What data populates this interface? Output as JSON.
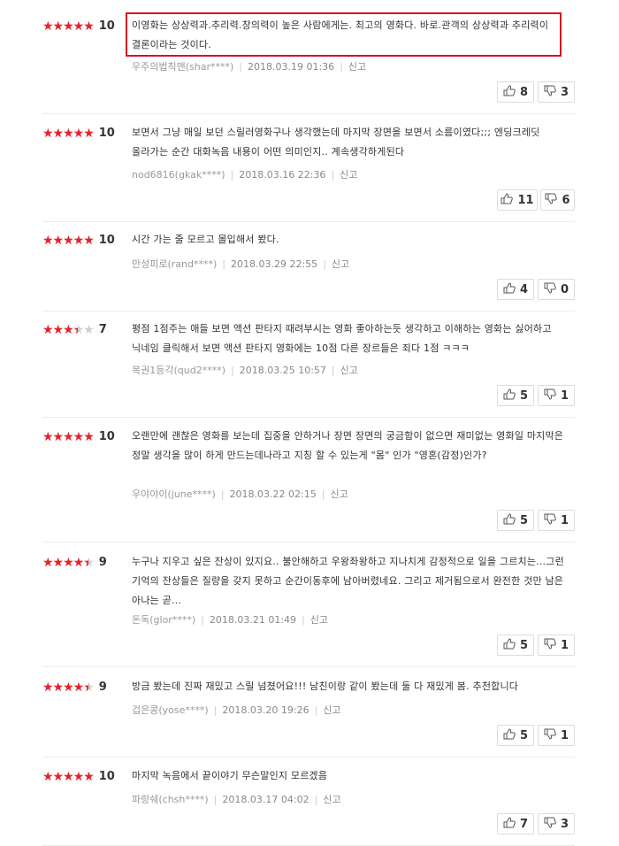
{
  "reviews": [
    {
      "rating": 10,
      "stars_fill": 1.0,
      "text": "이영화는 상상력과.추리력.창의력이 높은 사람에게는. 최고의 영화다. 바로.관객의 상상력과 추리력이 결론이라는 것이다.",
      "author": "우주의법칙맨(shar****)",
      "date": "2018.03.19 01:36",
      "report": "신고",
      "likes": "8",
      "dislikes": "3"
    },
    {
      "rating": 10,
      "stars_fill": 1.0,
      "text": "보면서 그냥 매일 보던 스릴러영화구나 생각했는데 마지막 장면을 보면서 소름이였다;;; 엔딩크레딧 올라가는 순간 대화녹음 내용이 어떤 의미인지.. 계속생각하게된다",
      "author": "nod6816(gkak****)",
      "date": "2018.03.16 22:36",
      "report": "신고",
      "likes": "11",
      "dislikes": "6"
    },
    {
      "rating": 10,
      "stars_fill": 1.0,
      "text": "시간 가는 줄 모르고 몰입해서 봤다.",
      "author": "만성피로(rand****)",
      "date": "2018.03.29 22:55",
      "report": "신고",
      "likes": "4",
      "dislikes": "0"
    },
    {
      "rating": 7,
      "stars_fill": 0.7,
      "text": "평점 1점주는 애들 보면 액션 판타지 때려부시는 영화 좋아하는듯 생각하고 이해하는 영화는 싫어하고 닉네임 클릭해서 보면 액션 판타지 영화에는 10점 다른 장르들은 죄다 1점 ㅋㅋㅋ",
      "author": "복권1등각(qud2****)",
      "date": "2018.03.25 10:57",
      "report": "신고",
      "likes": "5",
      "dislikes": "1"
    },
    {
      "rating": 10,
      "stars_fill": 1.0,
      "text": "오랜만에 괜찮은 영화를 보는데 집중을 안하거나 장면 장면의 궁금함이 없으면 재미없는 영화일 마지막은 정말 생각을 많이 하게 만드는데나라고 지칭 할 수 있는게 \"몸\" 인가 \"영혼(감정)인가?",
      "author": "우야야이(june****)",
      "date": "2018.03.22 02:15",
      "report": "신고",
      "likes": "5",
      "dislikes": "1"
    },
    {
      "rating": 9,
      "stars_fill": 0.9,
      "text": "누구나 지우고 싶은 잔상이 있지요.. 불안해하고 우왕좌왕하고 지나치게 감정적으로 일을 그르치는...그런 기억의 잔상들은 질량을 갖지 못하고 순간이동후에 남아버렸네요. 그리고 제거됨으로서 완전한 것만 남은 아나는 곧...",
      "author": "돈독(glor****)",
      "date": "2018.03.21 01:49",
      "report": "신고",
      "likes": "5",
      "dislikes": "1"
    },
    {
      "rating": 9,
      "stars_fill": 0.9,
      "text": "방금 봤는데 진짜 재밌고 스릴 넘쳤어요!!! 남친이랑 같이 봤는데 둘 다 재밌게 봄. 추천합니다",
      "author": "겁은콩(yose****)",
      "date": "2018.03.20 19:26",
      "report": "신고",
      "likes": "5",
      "dislikes": "1"
    },
    {
      "rating": 10,
      "stars_fill": 1.0,
      "text": "마지막 녹음에서 끝이야기 무슨말인지 모르겠음",
      "author": "파랑쉐(chsh****)",
      "date": "2018.03.17 04:02",
      "report": "신고",
      "likes": "7",
      "dislikes": "3"
    }
  ],
  "colors": {
    "star": "#e5222c",
    "highlight": "#d2161f"
  },
  "icons": {
    "like": "thumbs-up-icon",
    "dislike": "thumbs-down-icon"
  }
}
